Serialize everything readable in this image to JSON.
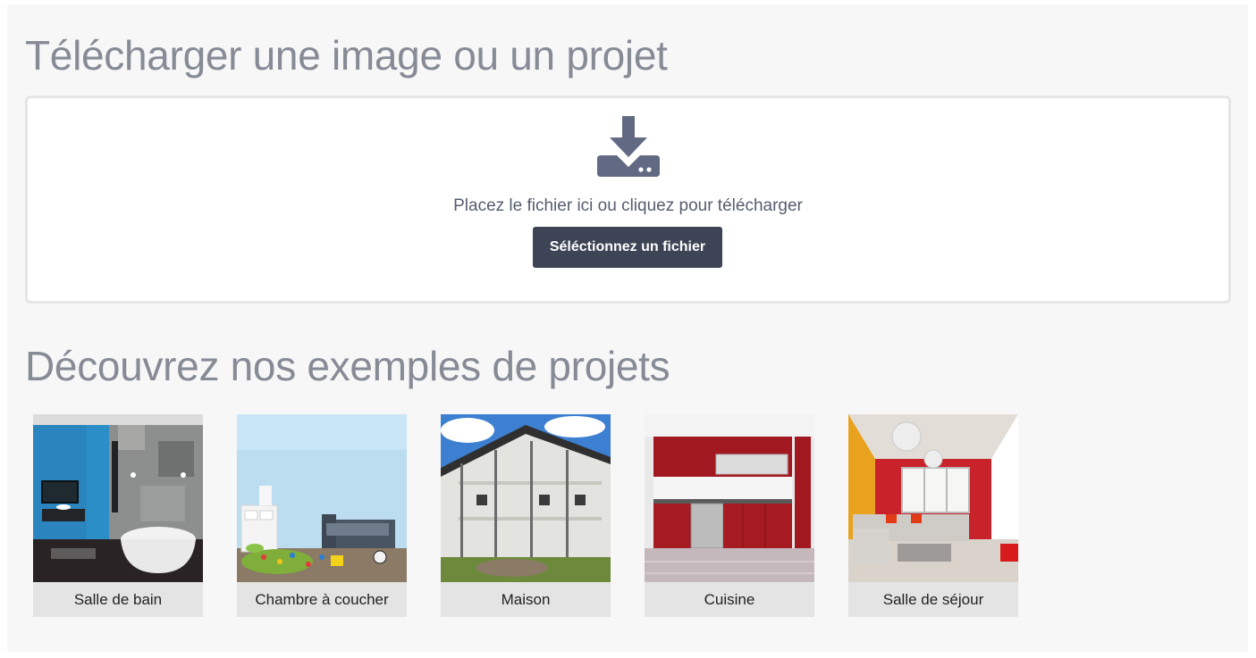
{
  "upload": {
    "title": "Télécharger une image ou un projet",
    "icon": "download-tray-icon",
    "instructions": "Placez le fichier ici ou cliquez pour télécharger",
    "button_label": "Séléctionnez un fichier"
  },
  "examples": {
    "title": "Découvrez nos exemples de projets",
    "items": [
      {
        "label": "Salle de bain"
      },
      {
        "label": "Chambre à coucher"
      },
      {
        "label": "Maison"
      },
      {
        "label": "Cuisine"
      },
      {
        "label": "Salle de séjour"
      }
    ]
  },
  "colors": {
    "panel_bg": "#f7f7f7",
    "heading": "#868b96",
    "button_bg": "#3d4455",
    "icon": "#616a82",
    "caption_bg": "#e4e4e4"
  }
}
